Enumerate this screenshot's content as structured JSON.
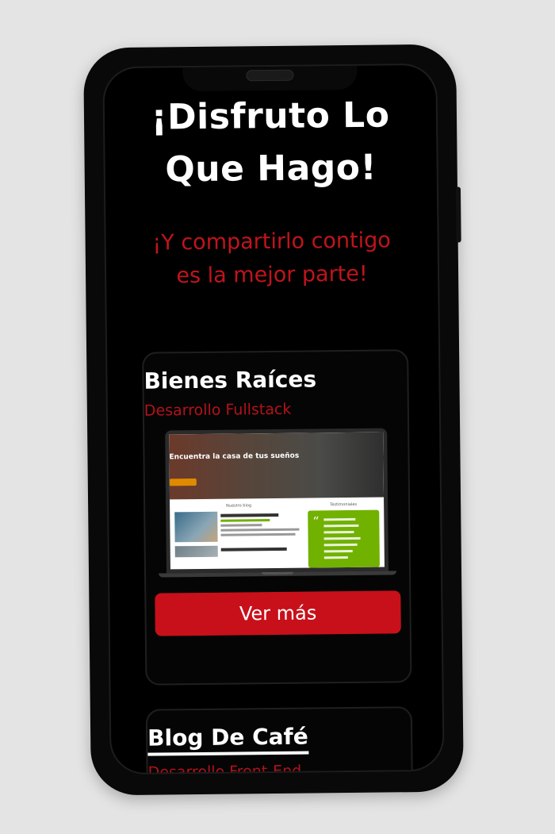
{
  "hero": {
    "title_line1": "¡Disfruto Lo",
    "title_line2": "Que Hago!",
    "subtitle_line1": "¡Y compartirlo contigo",
    "subtitle_line2": "es la mejor parte!"
  },
  "projects": [
    {
      "title": "Bienes Raíces",
      "subtitle": "Desarrollo Fullstack",
      "button_label": "Ver más",
      "preview": {
        "hero_title": "Encuentra la casa de tus sueños",
        "section_blog": "Nuestro blog",
        "section_testimonials": "Testimoniales"
      }
    },
    {
      "title": "Blog De Café",
      "subtitle": "Desarrollo Front-End"
    }
  ],
  "colors": {
    "accent": "#c8101a",
    "background": "#000000",
    "frame": "#e4e4e4"
  }
}
